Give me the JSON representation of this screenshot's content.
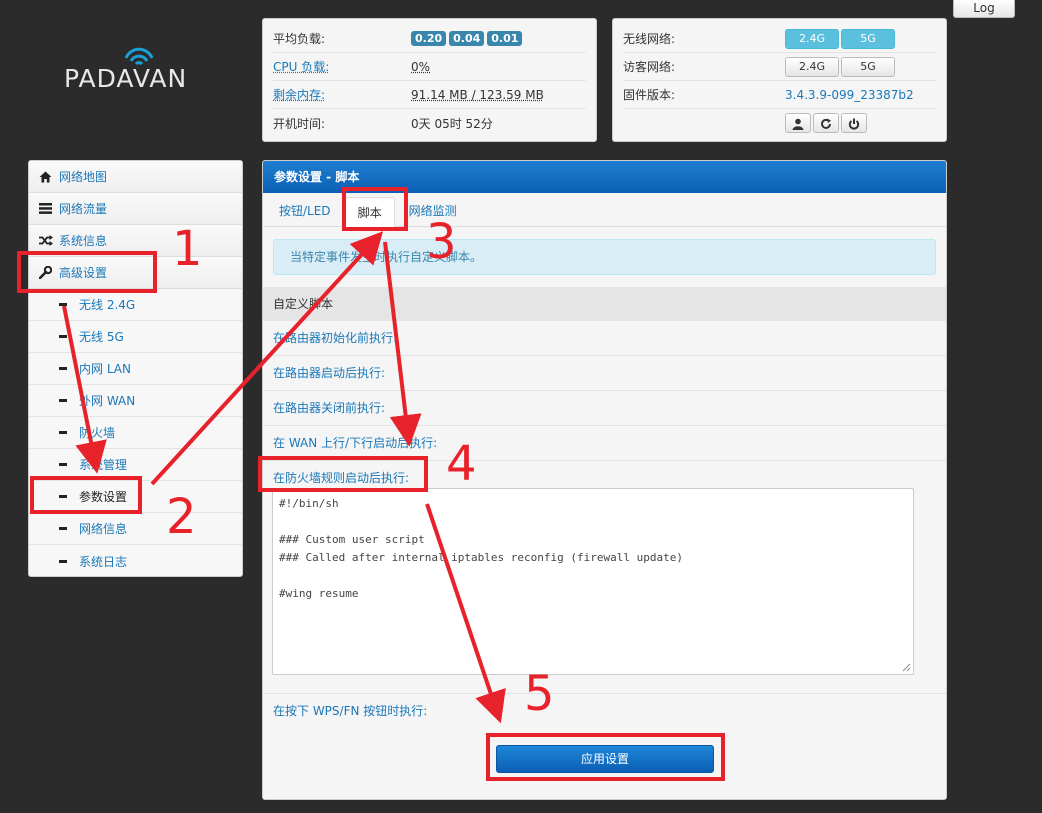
{
  "log_label": "Log",
  "logo": {
    "text": "PADAVAN"
  },
  "status": {
    "load_label": "平均负载:",
    "load_values": [
      "0.20",
      "0.04",
      "0.01"
    ],
    "cpu_label": "CPU 负载:",
    "cpu_value": "0%",
    "mem_label": "剩余内存:",
    "mem_value": "91.14 MB / 123.59 MB",
    "uptime_label": "开机时间:",
    "uptime_value": "0天 05时 52分"
  },
  "status2": {
    "wireless_label": "无线网络:",
    "guest_label": "访客网络:",
    "firmware_label": "固件版本:",
    "firmware_value": "3.4.3.9-099_23387b2",
    "band_24": "2.4G",
    "band_5": "5G"
  },
  "sidebar": {
    "items": [
      {
        "label": "网络地图",
        "icon": "home-icon"
      },
      {
        "label": "网络流量",
        "icon": "list-icon"
      },
      {
        "label": "系统信息",
        "icon": "shuffle-icon"
      },
      {
        "label": "高级设置",
        "icon": "wrench-icon"
      }
    ],
    "subitems": [
      "无线 2.4G",
      "无线 5G",
      "内网 LAN",
      "外网 WAN",
      "防火墙",
      "系统管理",
      "参数设置",
      "网络信息",
      "系统日志"
    ]
  },
  "main": {
    "header": "参数设置 - 脚本",
    "tabs": [
      "按钮/LED",
      "脚本",
      "网络监测"
    ],
    "alert": "当特定事件发生时执行自定义脚本。",
    "section": "自定义脚本",
    "rows": [
      "在路由器初始化前执行:",
      "在路由器启动后执行:",
      "在路由器关闭前执行:",
      "在 WAN 上行/下行启动后执行:",
      "在防火墙规则启动后执行:"
    ],
    "script_content": "#!/bin/sh\n\n### Custom user script\n### Called after internal iptables reconfig (firewall update)\n\n#wing resume",
    "wps_row": "在按下 WPS/FN 按钮时执行:",
    "apply": "应用设置"
  },
  "annotations": [
    "1",
    "2",
    "3",
    "4",
    "5"
  ],
  "colors": {
    "accent": "#1a78b8",
    "header_blue": "#0a5fb4",
    "annotation_red": "#e8222a"
  }
}
